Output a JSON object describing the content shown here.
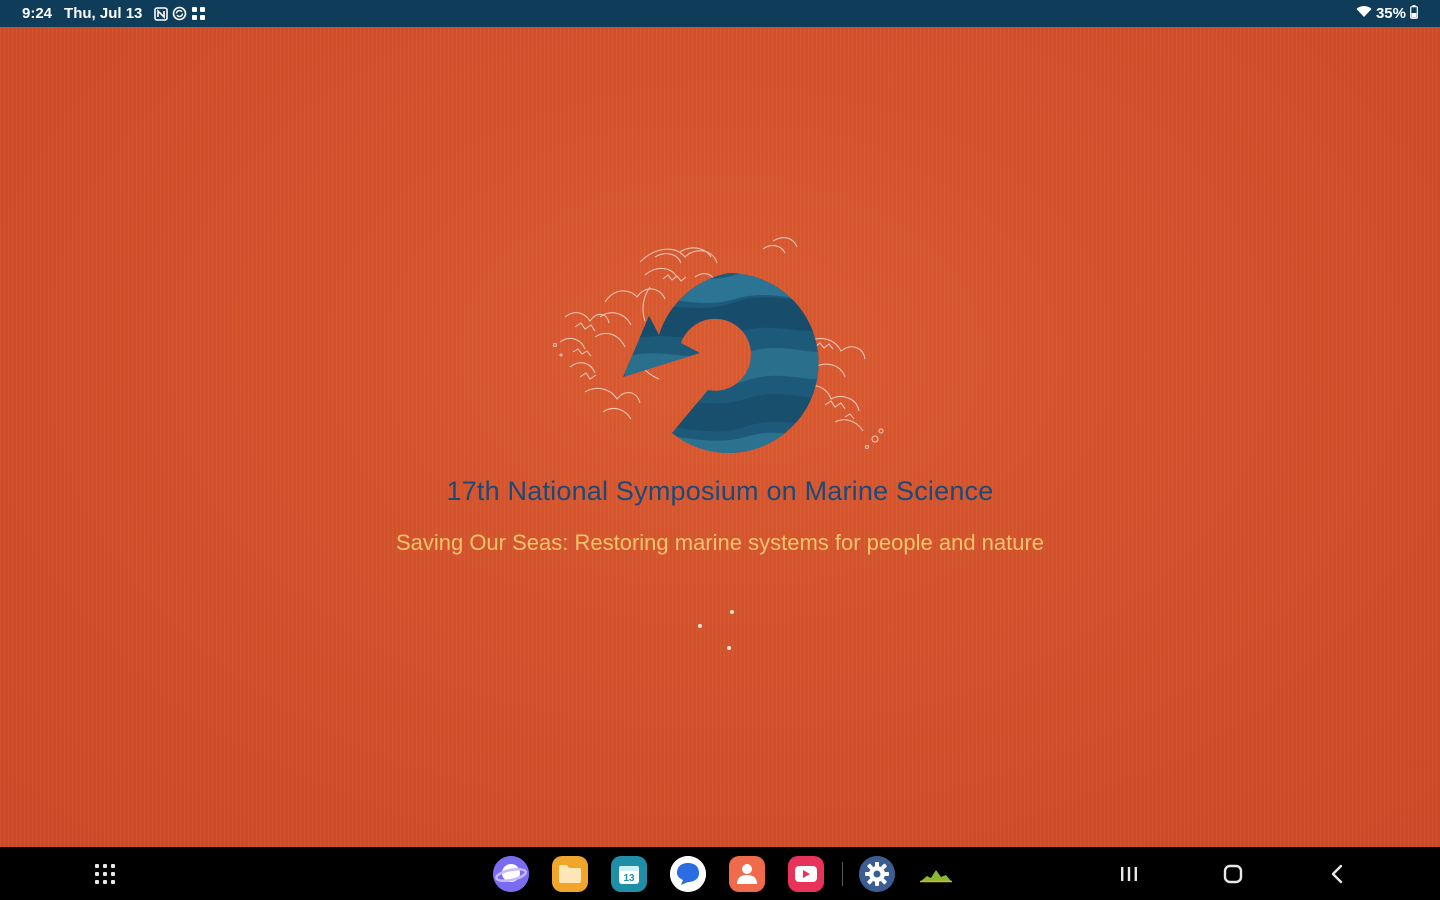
{
  "status_bar": {
    "time": "9:24",
    "date": "Thu, Jul 13",
    "battery": "35%",
    "icons": [
      "nfc-icon",
      "sync-icon",
      "apps-grid-icon",
      "wifi-icon",
      "battery-icon"
    ]
  },
  "splash": {
    "title": "17th National Symposium on Marine Science",
    "subtitle": "Saving Our Seas: Restoring marine systems for people and nature",
    "colors": {
      "background": "#d4502a",
      "title": "#1b4a78",
      "subtitle": "#f3c46c",
      "logo_ring": "#1d5a7a"
    },
    "loading": true
  },
  "nav_bar": {
    "apps": [
      {
        "name": "samsung-internet-icon",
        "color": "#7a6cf0"
      },
      {
        "name": "my-files-icon",
        "color": "#f1a52b"
      },
      {
        "name": "calendar-icon",
        "color": "#1f8fa8"
      },
      {
        "name": "messages-icon",
        "color": "#ffffff"
      },
      {
        "name": "contacts-icon",
        "color": "#f06a4c"
      },
      {
        "name": "youtube-icon",
        "color": "#e8325a"
      },
      {
        "name": "settings-icon",
        "color": "#3b5d91"
      },
      {
        "name": "chart-app-icon",
        "color": "#8ab833"
      }
    ],
    "buttons": [
      "app-drawer-button",
      "recents-button",
      "home-button",
      "back-button"
    ]
  }
}
